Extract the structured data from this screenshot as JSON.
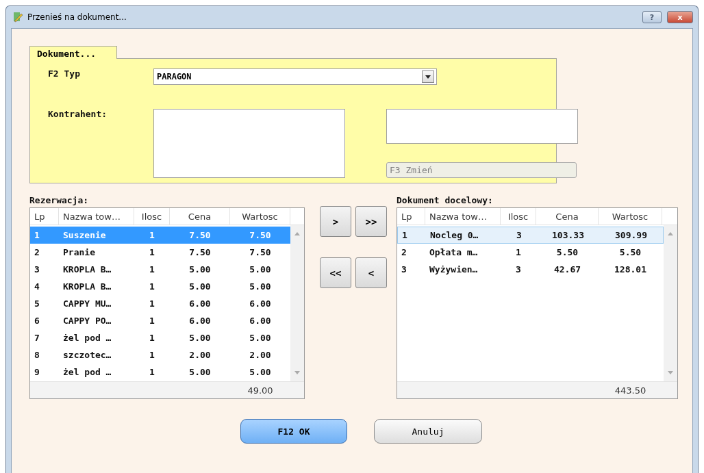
{
  "window": {
    "title": "Przenieś na dokument...",
    "buttons": [
      "?",
      "x"
    ]
  },
  "document_group": {
    "tab": "Dokument...",
    "type_label": "F2 Typ",
    "type_value": "PARAGON",
    "contractor_label": "Kontrahent:",
    "change_button": {
      "label": "F3 Zmień",
      "disabled": true
    }
  },
  "reservation": {
    "label": "Rezerwacja:",
    "focused": true,
    "columns": [
      "Lp",
      "Nazwa tow…",
      "Ilosc",
      "Cena",
      "Wartosc"
    ],
    "rows": [
      {
        "cells": [
          "1",
          "Suszenie",
          "1",
          "7.50",
          "7.50"
        ],
        "selected": true
      },
      {
        "cells": [
          "2",
          "Pranie",
          "1",
          "7.50",
          "7.50"
        ],
        "selected": false
      },
      {
        "cells": [
          "3",
          "KROPLA B…",
          "1",
          "5.00",
          "5.00"
        ],
        "selected": false
      },
      {
        "cells": [
          "4",
          "KROPLA B…",
          "1",
          "5.00",
          "5.00"
        ],
        "selected": false
      },
      {
        "cells": [
          "5",
          "CAPPY MU…",
          "1",
          "6.00",
          "6.00"
        ],
        "selected": false
      },
      {
        "cells": [
          "6",
          "CAPPY PO…",
          "1",
          "6.00",
          "6.00"
        ],
        "selected": false
      },
      {
        "cells": [
          "7",
          "żel pod …",
          "1",
          "5.00",
          "5.00"
        ],
        "selected": false
      },
      {
        "cells": [
          "8",
          "szczotec…",
          "1",
          "2.00",
          "2.00"
        ],
        "selected": false
      },
      {
        "cells": [
          "9",
          "żel pod …",
          "1",
          "5.00",
          "5.00"
        ],
        "selected": false
      }
    ],
    "total": "49.00"
  },
  "transfer_buttons": [
    ">",
    ">>",
    "<<",
    "<"
  ],
  "target": {
    "label": "Dokument docelowy:",
    "focused": false,
    "columns": [
      "Lp",
      "Nazwa tow…",
      "Ilosc",
      "Cena",
      "Wartosc"
    ],
    "rows": [
      {
        "cells": [
          "1",
          "Nocleg 0…",
          "3",
          "103.33",
          "309.99"
        ],
        "selected": true
      },
      {
        "cells": [
          "2",
          "Opłata m…",
          "1",
          "5.50",
          "5.50"
        ],
        "selected": false
      },
      {
        "cells": [
          "3",
          "Wyżywien…",
          "3",
          "42.67",
          "128.01"
        ],
        "selected": false
      }
    ],
    "total": "443.50"
  },
  "buttons": [
    {
      "label": "F12 OK",
      "kind": "default"
    },
    {
      "label": "Anuluj",
      "kind": "normal"
    }
  ]
}
